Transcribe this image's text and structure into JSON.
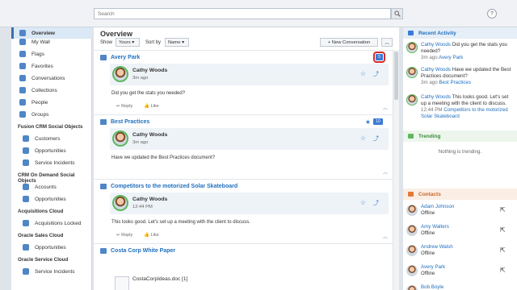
{
  "search": {
    "placeholder": "Search"
  },
  "help": "?",
  "sidebar": {
    "items": [
      {
        "label": "Overview"
      },
      {
        "label": "My Wall"
      },
      {
        "label": "Flags"
      },
      {
        "label": "Favorites"
      },
      {
        "label": "Conversations"
      },
      {
        "label": "Collections"
      },
      {
        "label": "People"
      },
      {
        "label": "Groups"
      }
    ],
    "sections": [
      {
        "title": "Fusion CRM Social Objects",
        "items": [
          "Customers",
          "Opportunities",
          "Service Incidents"
        ]
      },
      {
        "title": "CRM On Demand Social Objects",
        "items": [
          "Accounts",
          "Opportunities"
        ]
      },
      {
        "title": "Acquisitions Cloud",
        "items": [
          "Acquisitions Locked"
        ]
      },
      {
        "title": "Oracle Sales Cloud",
        "items": [
          "Opportunities"
        ]
      },
      {
        "title": "Oracle Service Cloud",
        "items": [
          "Service Incidents"
        ]
      }
    ]
  },
  "main": {
    "title": "Overview",
    "show_label": "Show",
    "show_value": "Yours ▾",
    "sort_label": "Sort by",
    "sort_value": "Name ▾",
    "new_conversation": "+ New Conversation",
    "conversations": [
      {
        "title": "Avery Park",
        "badge": "5",
        "author": "Cathy Woods",
        "time": "3m ago",
        "text": "Did you get the stats you needed?",
        "reply": "↩ Reply",
        "like": "👍 Like"
      },
      {
        "title": "Best Practices",
        "badge": "10",
        "author": "Cathy Woods",
        "time": "3m ago",
        "text": "Have we updated the Best Practices document?"
      },
      {
        "title": "Competitors to the motorized Solar Skateboard",
        "author": "Cathy Woods",
        "time": "12:44 PM",
        "text": "This looks good. Let's set up a meeting with the client to discuss.",
        "reply": "↩ Reply",
        "like": "👍 Like"
      },
      {
        "title": "Costa Corp White Paper",
        "doc": "CostaCorpIdeas.doc [1]"
      }
    ]
  },
  "right": {
    "recent_title": "Recent Activity",
    "recent": [
      {
        "name": "Cathy Woods",
        "text": " Did you get the stats you needed?",
        "time": "3m ago",
        "target": "Avery Park"
      },
      {
        "name": "Cathy Woods",
        "text": " Have we updated the Best Practices document?",
        "time": "3m ago",
        "target": "Best Practices"
      },
      {
        "name": "Cathy Woods",
        "text": " This looks good. Let's set up a meeting with the client to discuss.",
        "time": "12:44 PM",
        "target": "Competitors to the motorized Solar Skateboard"
      }
    ],
    "trending_title": "Trending",
    "trending_empty": "Nothing is trending.",
    "contacts_title": "Contacts",
    "contacts": [
      {
        "name": "Adam Johnson",
        "status": "Offline"
      },
      {
        "name": "Amy Walters",
        "status": "Offline"
      },
      {
        "name": "Andrew Walsh",
        "status": "Offline"
      },
      {
        "name": "Avery Park",
        "status": "Offline"
      },
      {
        "name": "Bob Boyle",
        "status": ""
      }
    ]
  }
}
